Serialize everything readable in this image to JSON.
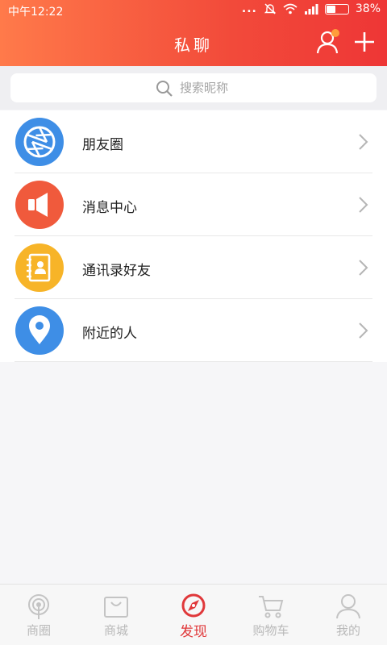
{
  "status_bar": {
    "time": "中午12:22",
    "battery": "38%",
    "battery_level": 0.38,
    "dots": "..."
  },
  "header": {
    "title": "私聊"
  },
  "search": {
    "placeholder": "搜索昵称"
  },
  "menu": [
    {
      "label": "朋友圈",
      "icon": "aperture-icon",
      "color": "#3e8ee6"
    },
    {
      "label": "消息中心",
      "icon": "speaker-icon",
      "color": "#f05a3c"
    },
    {
      "label": "通讯录好友",
      "icon": "contacts-book-icon",
      "color": "#f7b428"
    },
    {
      "label": "附近的人",
      "icon": "location-pin-icon",
      "color": "#3e8ee6"
    }
  ],
  "tabs": [
    {
      "label": "商圈",
      "icon": "broadcast-icon",
      "active": false
    },
    {
      "label": "商城",
      "icon": "shopping-bag-icon",
      "active": false
    },
    {
      "label": "发现",
      "icon": "compass-icon",
      "active": true
    },
    {
      "label": "购物车",
      "icon": "cart-icon",
      "active": false
    },
    {
      "label": "我的",
      "icon": "user-icon",
      "active": false
    }
  ],
  "colors": {
    "accent": "#e0383a",
    "header_start": "#ff7a4a",
    "header_end": "#ee3636",
    "inactive_tab": "#b9b9b9"
  }
}
